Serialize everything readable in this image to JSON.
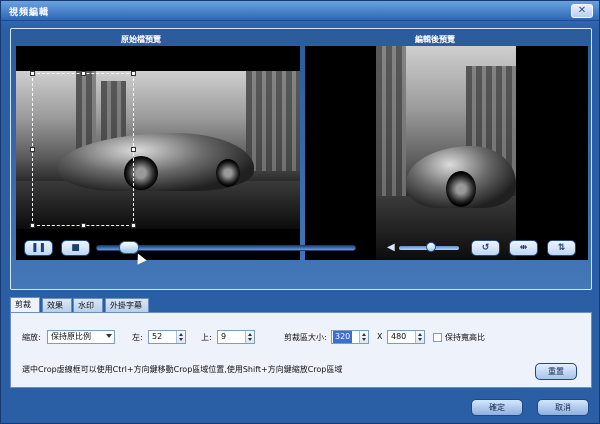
{
  "window": {
    "title": "視頻編輯",
    "close_glyph": "✕"
  },
  "preview": {
    "left_label": "原始檔預覽",
    "right_label": "編輯後預覽"
  },
  "controls": {
    "pause_glyph": "❚❚",
    "stop_glyph": "■",
    "rotate_glyph": "↺",
    "flip_h_glyph": "⇹",
    "flip_v_glyph": "⇅",
    "volume_glyph": "◀",
    "seek_progress": 0.14,
    "volume_level": 0.45
  },
  "tabs": [
    {
      "label": "剪裁",
      "active": true
    },
    {
      "label": "效果",
      "active": false
    },
    {
      "label": "水印",
      "active": false
    },
    {
      "label": "外掛字幕",
      "active": false
    }
  ],
  "crop": {
    "zoom_label": "縮放:",
    "zoom_value": "保持原比例",
    "left_label": "左:",
    "left_value": "52",
    "top_label": "上:",
    "top_value": "9",
    "area_label": "剪裁區大小:",
    "width_value": "320",
    "x_label": "X",
    "height_value": "480",
    "keep_ratio_label": "保持寬高比",
    "keep_ratio_checked": false,
    "hint": "選中Crop虛線框可以使用Ctrl+方向鍵移動Crop區域位置,使用Shift+方向鍵縮放Crop區域",
    "reset_label": "重置"
  },
  "footer": {
    "ok_label": "確定",
    "cancel_label": "取消"
  }
}
